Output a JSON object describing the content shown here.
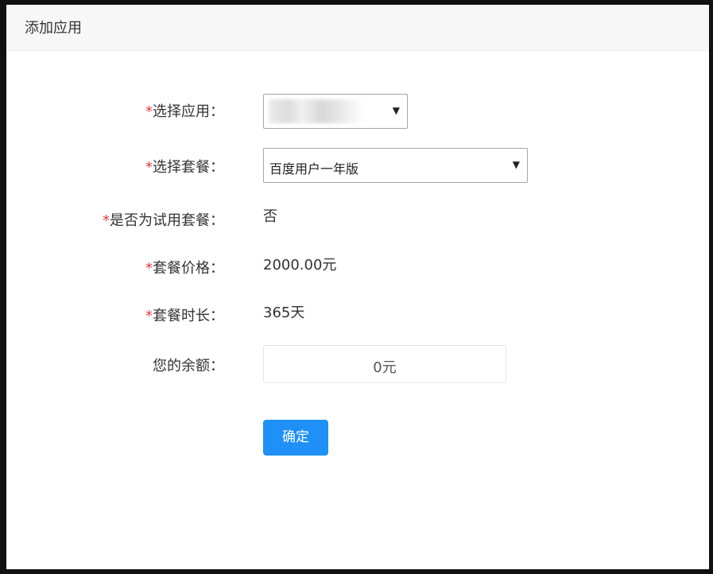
{
  "dialog": {
    "title": "添加应用"
  },
  "form": {
    "required_mark": "*",
    "select_app": {
      "label": "选择应用：",
      "value": ""
    },
    "select_package": {
      "label": "选择套餐：",
      "value": "百度用户一年版"
    },
    "is_trial": {
      "label": "是否为试用套餐：",
      "value": "否"
    },
    "package_price": {
      "label": "套餐价格：",
      "value": "2000.00元"
    },
    "package_duration": {
      "label": "套餐时长：",
      "value": "365天"
    },
    "balance": {
      "label": "您的余额：",
      "value": "0元"
    },
    "confirm_label": "确定",
    "caret_glyph": "▼"
  },
  "colors": {
    "required": "#e4393c",
    "primary_button": "#1e90f7",
    "header_bg": "#f7f7f7",
    "backdrop": "#111111"
  },
  "icons": {
    "select_caret": "caret-down-icon"
  }
}
